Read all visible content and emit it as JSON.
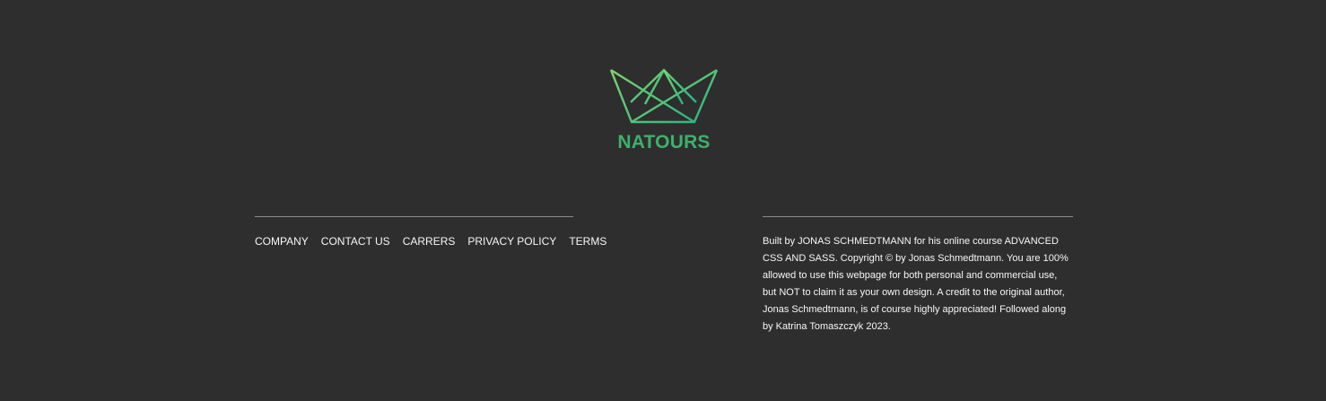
{
  "logo": {
    "icon": "crown-icon",
    "text": "NATOURS",
    "gradient": [
      "#7ed56f",
      "#28b485"
    ]
  },
  "footer_nav": {
    "items": [
      {
        "label": "COMPANY"
      },
      {
        "label": "CONTACT US"
      },
      {
        "label": "CARRERS"
      },
      {
        "label": "PRIVACY POLICY"
      },
      {
        "label": "TERMS"
      }
    ]
  },
  "copyright": {
    "text": "Built by JONAS SCHMEDTMANN for his online course ADVANCED CSS AND SASS. Copyright © by Jonas Schmedtmann. You are 100% allowed to use this webpage for both personal and commercial use, but NOT to claim it as your own design. A credit to the original author, Jonas Schmedtmann, is of course highly appreciated! Followed along by Katrina Tomaszczyk 2023."
  },
  "colors": {
    "background": "#2e2e2e",
    "text": "#f7f7f7",
    "divider": "#8a8a8a",
    "logo_text": "#3fb06b"
  }
}
